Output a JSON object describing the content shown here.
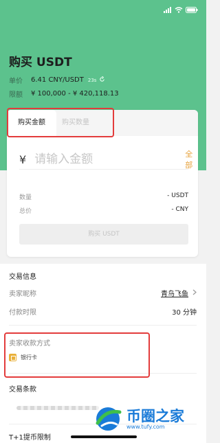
{
  "header": {
    "title": "购买 USDT",
    "price_label": "单价",
    "price_value": "6.41 CNY/USDT",
    "timer": "23s",
    "limit_label": "限额",
    "limit_value": "¥ 100,000 - ¥ 420,118.13"
  },
  "tabs": [
    {
      "label": "购买金额"
    },
    {
      "label": "购买数量"
    }
  ],
  "amount": {
    "currency_symbol": "¥",
    "placeholder": "请输入金额",
    "all_label": "全部"
  },
  "summary": {
    "quantity_label": "数量",
    "quantity_value": "- USDT",
    "total_label": "总价",
    "total_value": "- CNY"
  },
  "buy_button_label": "购买 USDT",
  "trade_info": {
    "title": "交易信息",
    "seller_label": "卖家昵称",
    "seller_value": "青鸟飞鱼",
    "pay_time_label": "付款时限",
    "pay_time_value": "30 分钟"
  },
  "payment": {
    "title": "卖家收款方式",
    "method": "银行卡"
  },
  "terms_title": "交易条款",
  "t1_title": "T+1提币限制",
  "watermark": {
    "name": "币圈之家",
    "url": "www.tufy.com"
  },
  "colors": {
    "hero_green": "#5cc28d",
    "accent_orange": "#e6a23c",
    "highlight_red": "#e33b3b",
    "watermark_blue": "#1a7bd8"
  }
}
